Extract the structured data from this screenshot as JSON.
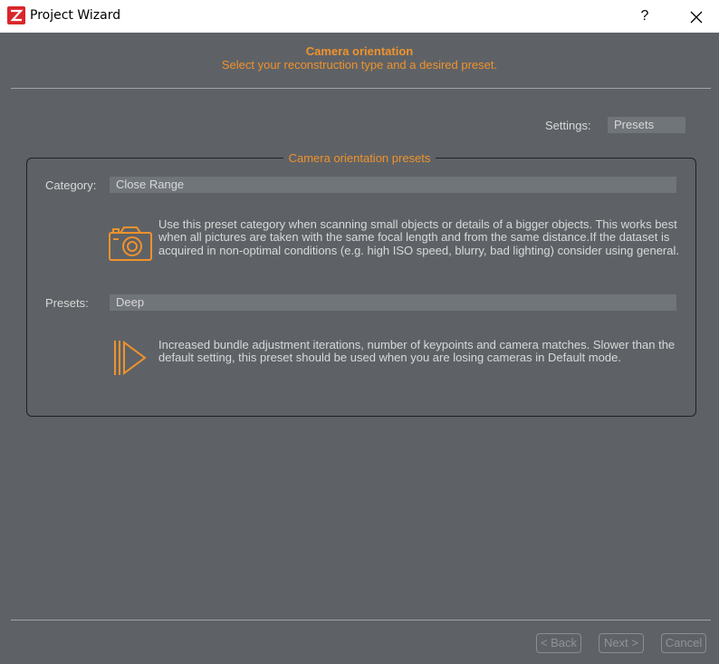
{
  "window": {
    "title": "Project Wizard",
    "help_label": "?",
    "close_label": "✕"
  },
  "header": {
    "title": "Camera orientation",
    "subtitle": "Select your reconstruction type and a desired preset."
  },
  "settings": {
    "label": "Settings:",
    "value": "Presets"
  },
  "group": {
    "title": "Camera orientation presets",
    "category": {
      "label": "Category:",
      "value": "Close Range",
      "icon": "camera-icon",
      "description": "Use this preset category when scanning small objects or details of a bigger objects. This works best when all pictures are taken with the same focal length and from the same distance.If the dataset is acquired in non-optimal conditions (e.g. high ISO speed, blurry, bad lighting) consider using general."
    },
    "presets": {
      "label": "Presets:",
      "value": "Deep",
      "icon": "play-deep-icon",
      "description": "Increased bundle adjustment iterations, number of keypoints and camera matches. Slower than the default setting, this preset should be used when you are losing cameras in Default mode."
    }
  },
  "footer": {
    "back_label": "< Back",
    "next_label": "Next >",
    "cancel_label": "Cancel"
  },
  "colors": {
    "accent": "#f0922c",
    "background": "#5e6266",
    "field": "#70757a"
  }
}
